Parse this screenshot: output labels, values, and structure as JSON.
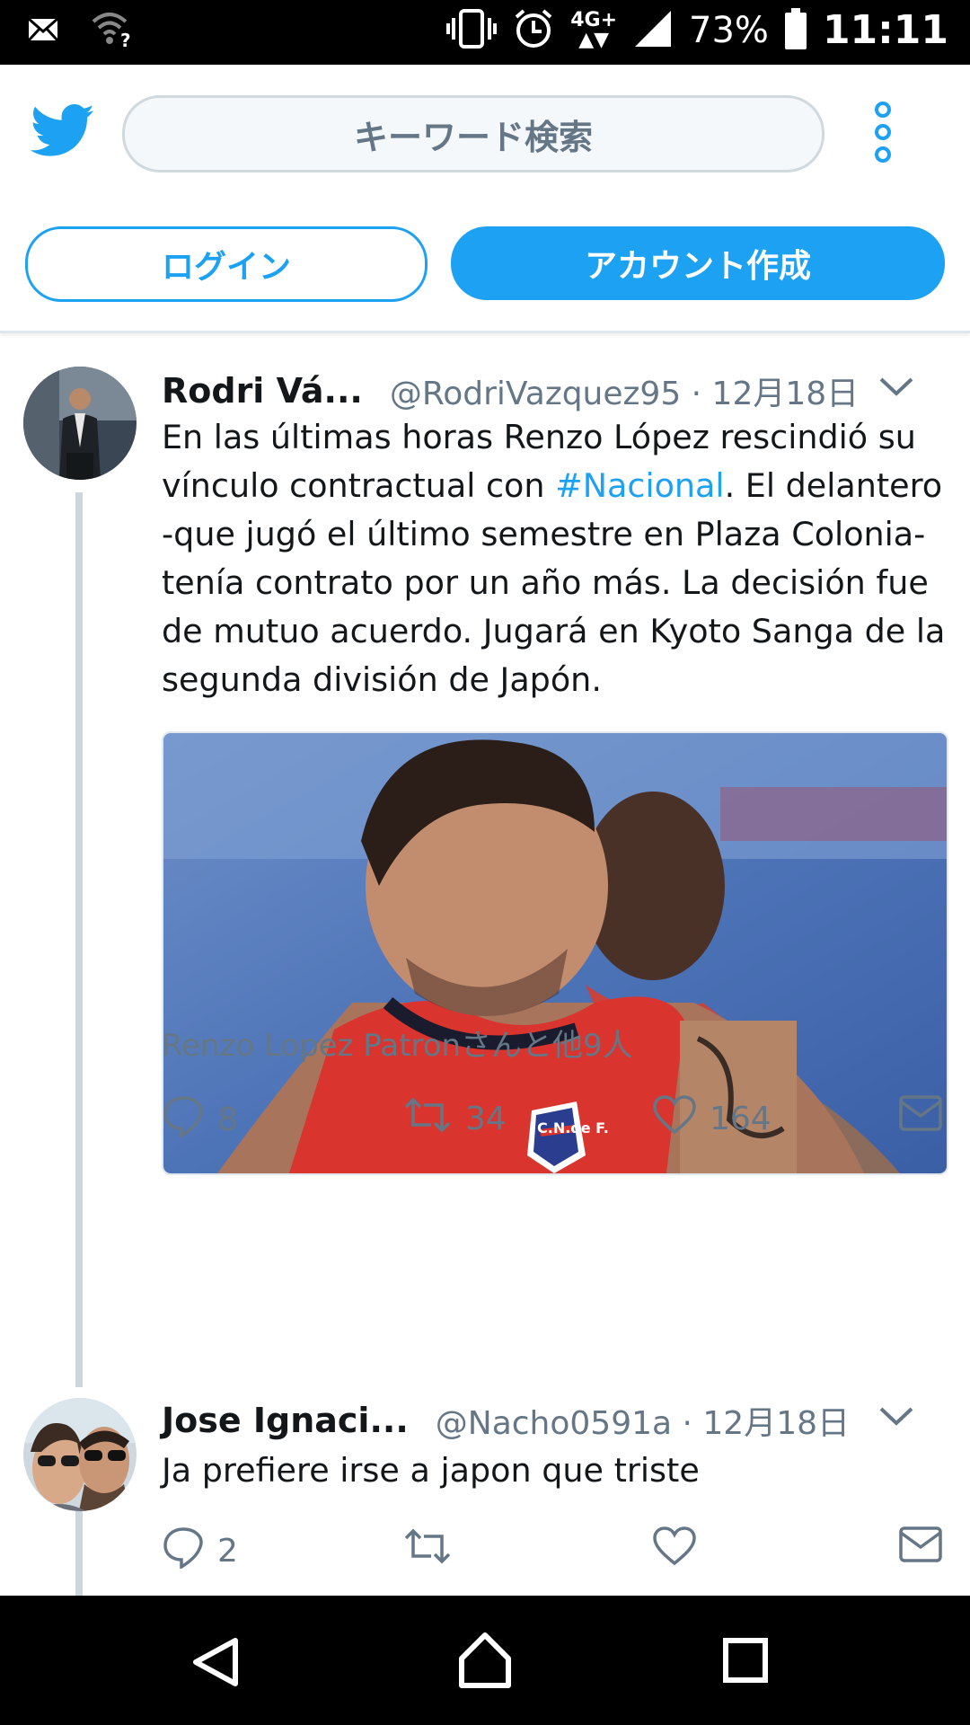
{
  "status_bar": {
    "network": "4G+",
    "battery": "73%",
    "time": "11:11"
  },
  "header": {
    "search_placeholder": "キーワード検索",
    "login_label": "ログイン",
    "signup_label": "アカウント作成"
  },
  "tweets": [
    {
      "name": "Rodri Vá...",
      "handle": "@RodriVazquez95 · 12月18日",
      "text_before": "En las últimas horas Renzo López rescindió su vínculo contractual con ",
      "hashtag": "#Nacional",
      "text_after": ". El delantero -que jugó el último semestre en Plaza Colonia- tenía contrato por un año más. La decisión fue de mutuo acuerdo. Jugará en Kyoto Sanga de la segunda división de Japón.",
      "likers": "Renzo Lopez Patronさんと他9人",
      "replies": "8",
      "retweets": "34",
      "likes": "164",
      "jersey_badge": "C.N.de F."
    },
    {
      "name": "Jose Ignaci...",
      "handle": "@Nacho0591a · 12月18日",
      "text": "Ja prefiere irse a japon que triste",
      "replies": "2",
      "retweets": "",
      "likes": ""
    }
  ],
  "icons": {
    "status_left": [
      "mail-icon",
      "wifi-icon"
    ],
    "status_right": [
      "vibrate-icon",
      "alarm-icon",
      "signal-icon",
      "battery-icon"
    ],
    "tweet_actions": [
      "reply-icon",
      "retweet-icon",
      "like-icon",
      "message-icon"
    ],
    "nav": [
      "back-icon",
      "home-icon",
      "recents-icon"
    ]
  },
  "colors": {
    "brand": "#1da1f2",
    "secondary_text": "#657786",
    "thread_line": "#ccd6dd"
  }
}
